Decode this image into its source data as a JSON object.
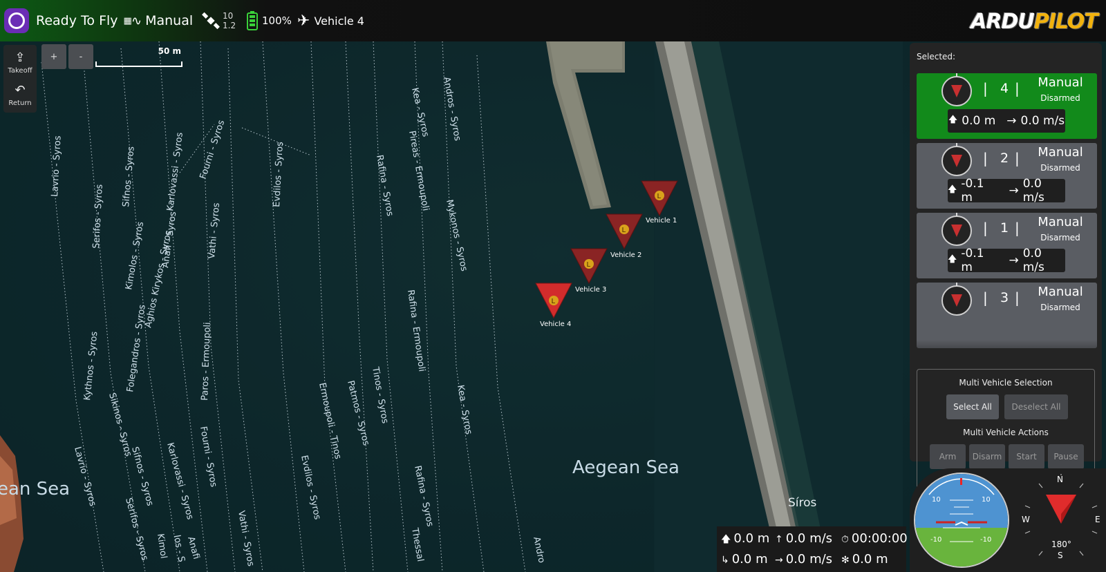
{
  "toolbar": {
    "status": "Ready To Fly",
    "flight_mode": "Manual",
    "sat_count": "10",
    "hdop": "1.2",
    "battery": "100%",
    "vehicle": "Vehicle 4",
    "brand_prefix": "ARDU",
    "brand_suffix": "PILOT"
  },
  "tools": {
    "takeoff": "Takeoff",
    "return": "Return",
    "zoom_in": "+",
    "zoom_out": "-",
    "scale": "50 m"
  },
  "map": {
    "sea_label_main": "Aegean Sea",
    "sea_label_left": "ean Sea",
    "city_label": "Síros",
    "routes": [
      "Lavrio - Syros",
      "Serifos - Syros",
      "Sifnos - Syros",
      "Kimolos - Syros",
      "Karlovassi - Syros",
      "Aghios Kirykos - Syros",
      "Anafi - Syros",
      "Fourni - Syros",
      "Vathi - Syros",
      "Evdilos - Syros",
      "Kea - Syros",
      "Pireas - Ermoupoli",
      "Andros - Syros",
      "Rafina - Syros",
      "Mykonos - Syros",
      "Folegandros - Syros",
      "Kythnos - Syros",
      "Paros - Ermoupoli",
      "Rafina - Ermoupoli",
      "Sikinos - Syros",
      "Ermoupoli - Tinos",
      "Patmos - Syros",
      "Tinos - Syros",
      "Kea - Syros",
      "Lavrio - Syros",
      "Sifnos - Syros",
      "Karlovassi - Syros",
      "Fourni - Syros",
      "Evdilos - Syros",
      "Rafina - Syros",
      "Serifos - Syros",
      "Kimol",
      "Ios - S",
      "Anafi",
      "Vathi - Syros",
      "Thessal",
      "Andro"
    ],
    "vehicle_markers": [
      {
        "label": "Vehicle 1",
        "letter": "L"
      },
      {
        "label": "Vehicle 2",
        "letter": "L"
      },
      {
        "label": "Vehicle 3",
        "letter": "L"
      },
      {
        "label": "Vehicle 4",
        "letter": "L"
      }
    ]
  },
  "panel": {
    "selected_label": "Selected:",
    "vehicles": [
      {
        "id": "4",
        "mode": "Manual",
        "armed": "Disarmed",
        "alt": "0.0 m",
        "speed": "0.0 m/s",
        "active": true
      },
      {
        "id": "2",
        "mode": "Manual",
        "armed": "Disarmed",
        "alt": "-0.1 m",
        "speed": "0.0 m/s",
        "active": false
      },
      {
        "id": "1",
        "mode": "Manual",
        "armed": "Disarmed",
        "alt": "-0.1 m",
        "speed": "0.0 m/s",
        "active": false
      },
      {
        "id": "3",
        "mode": "Manual",
        "armed": "Disarmed",
        "alt": "",
        "speed": "",
        "active": false
      }
    ],
    "multi_selection_title": "Multi Vehicle Selection",
    "select_all": "Select All",
    "deselect_all": "Deselect All",
    "multi_actions_title": "Multi Vehicle Actions",
    "arm": "Arm",
    "disarm": "Disarm",
    "start": "Start",
    "pause": "Pause"
  },
  "telemetry": {
    "altitude": "0.0 m",
    "vertical_speed": "0.0 m/s",
    "flight_time": "00:00:00",
    "distance": "0.0 m",
    "ground_speed": "0.0 m/s",
    "home_distance": "0.0 m"
  },
  "instruments": {
    "pitch_up": "10",
    "pitch_down": "-10",
    "heading": "180°",
    "compass_n": "N",
    "compass_e": "E",
    "compass_s": "S",
    "compass_w": "W"
  },
  "colors": {
    "active_card": "#128a1b",
    "vehicle_marker": "#c83030",
    "brand_yellow": "#f2b20d"
  }
}
